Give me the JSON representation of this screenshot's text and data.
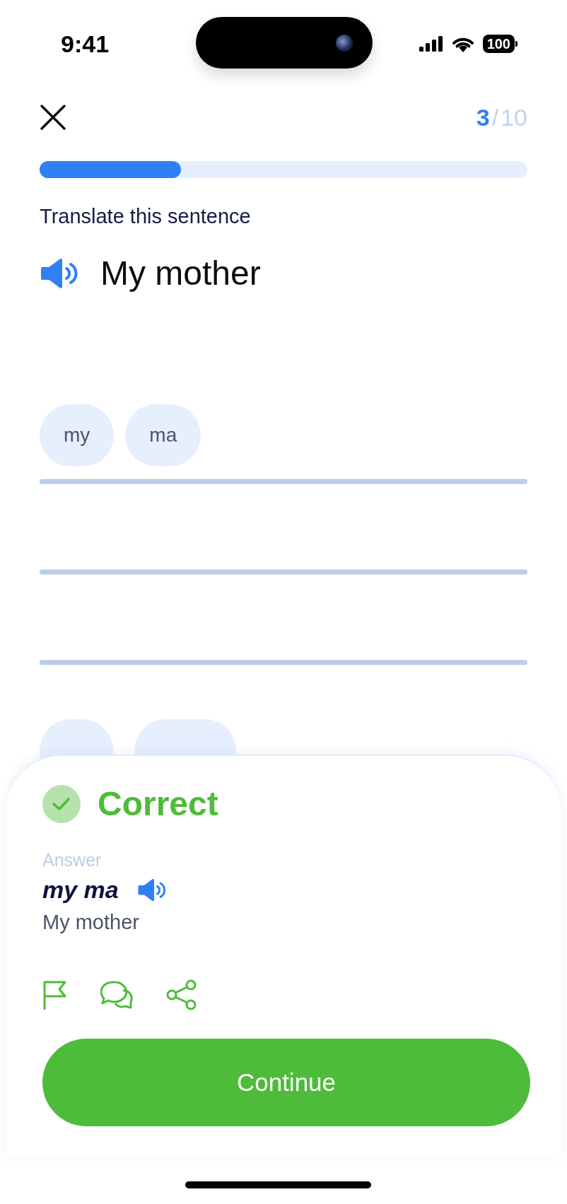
{
  "status_bar": {
    "time": "9:41",
    "battery": "100"
  },
  "header": {
    "current": "3",
    "separator": "/",
    "total": "10"
  },
  "progress": {
    "level": 0.29
  },
  "instruction": "Translate this sentence",
  "prompt": "My mother",
  "answer_chips": [
    "my",
    "ma"
  ],
  "result": {
    "kind": "correct",
    "title": "Correct",
    "answer_label": "Answer",
    "answer": "my ma",
    "translation": "My mother"
  },
  "continue_button": "Continue"
}
